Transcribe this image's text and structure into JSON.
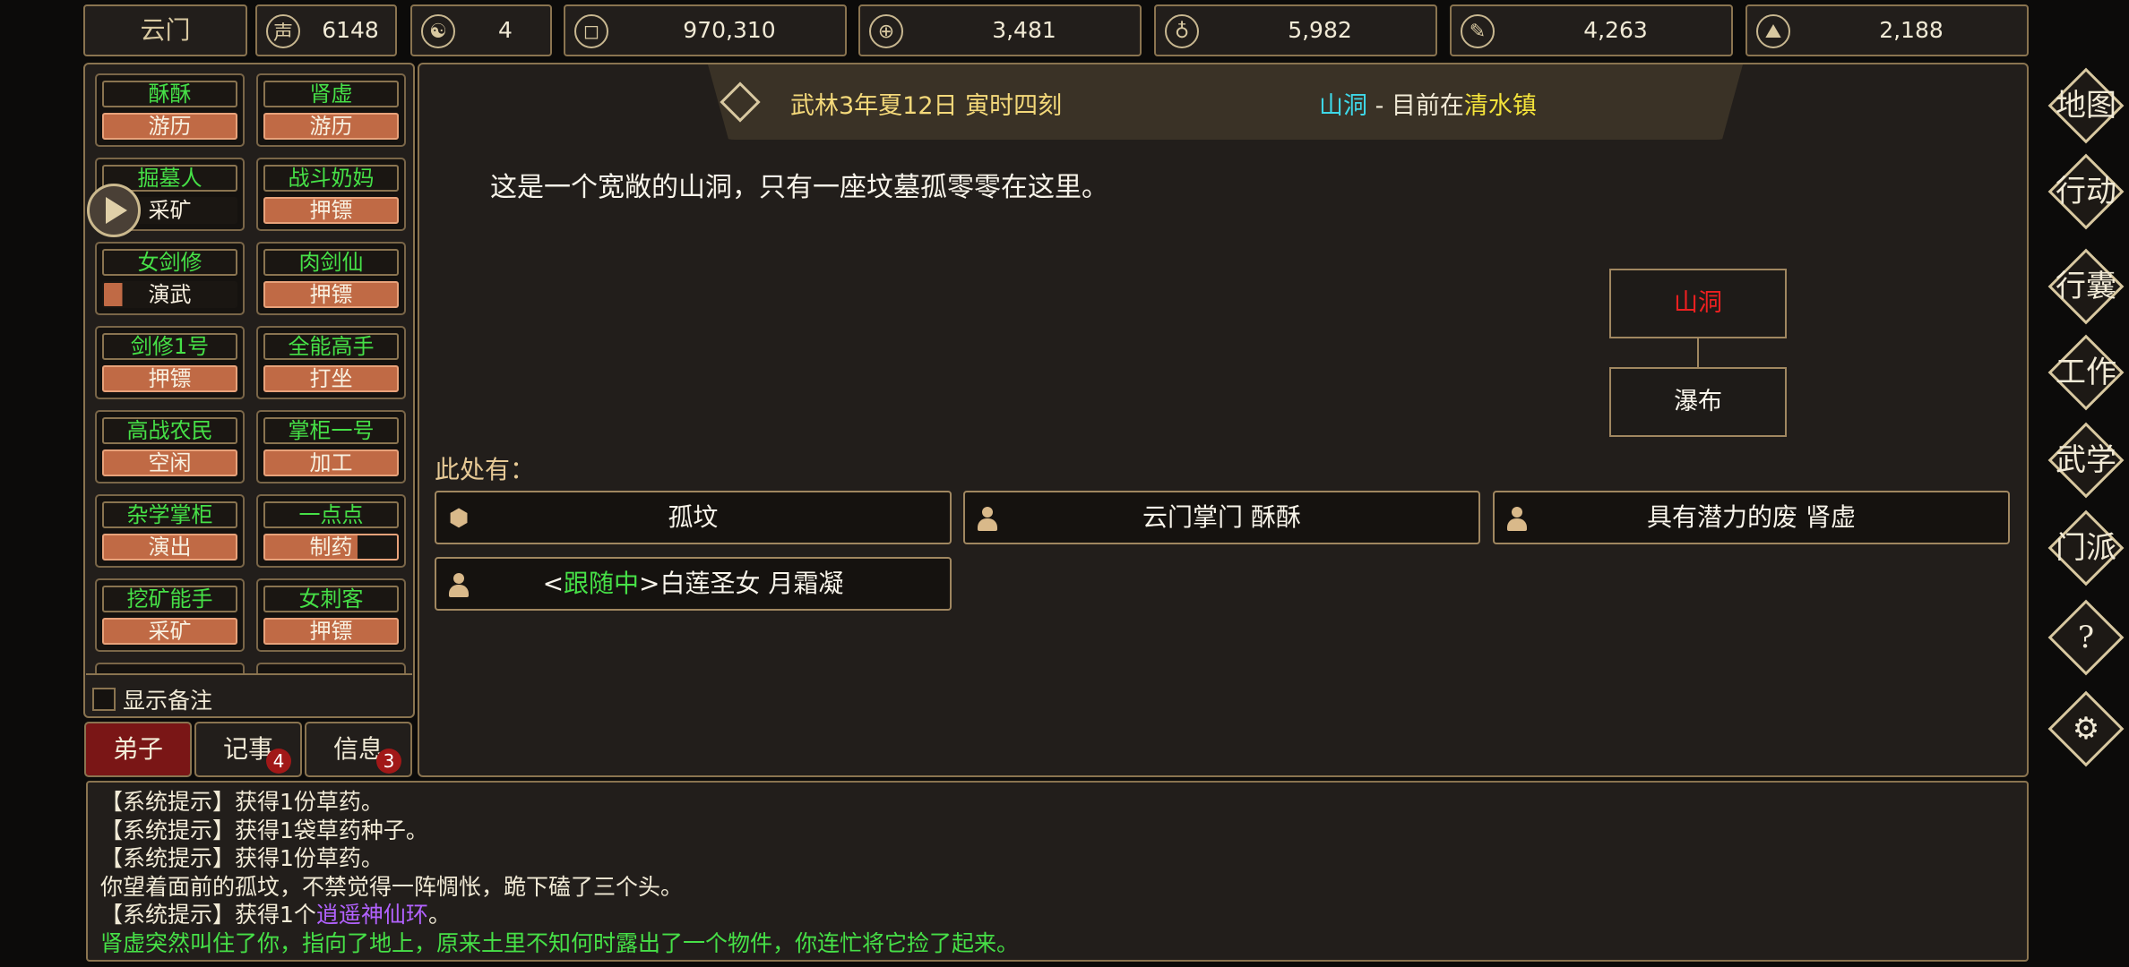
{
  "sect": {
    "name": "云门"
  },
  "resources": [
    {
      "icon": "reputation-icon",
      "glyph": "声",
      "value": "6148"
    },
    {
      "icon": "yin-yang-icon",
      "glyph": "☯",
      "value": "4"
    },
    {
      "icon": "coin-icon",
      "glyph": "◻",
      "value": "970,310"
    },
    {
      "icon": "rice-bowl-icon",
      "glyph": "⊕",
      "value": "3,481"
    },
    {
      "icon": "gourd-icon",
      "glyph": "♁",
      "value": "5,982"
    },
    {
      "icon": "scroll-icon",
      "glyph": "✎",
      "value": "4,263"
    },
    {
      "icon": "ore-icon",
      "glyph": "⛰",
      "value": "2,188"
    }
  ],
  "disciples": [
    {
      "name": "酥酥",
      "activity": "游历"
    },
    {
      "name": "肾虚",
      "activity": "游历"
    },
    {
      "name": "掘墓人",
      "activity": "采矿"
    },
    {
      "name": "战斗奶妈",
      "activity": "押镖"
    },
    {
      "name": "女剑修",
      "activity": "演武"
    },
    {
      "name": "肉剑仙",
      "activity": "押镖"
    },
    {
      "name": "剑修1号",
      "activity": "押镖"
    },
    {
      "name": "全能高手",
      "activity": "打坐"
    },
    {
      "name": "高战农民",
      "activity": "空闲"
    },
    {
      "name": "掌柜一号",
      "activity": "加工"
    },
    {
      "name": "杂学掌柜",
      "activity": "演出"
    },
    {
      "name": "一点点",
      "activity": "制药"
    },
    {
      "name": "挖矿能手",
      "activity": "采矿"
    },
    {
      "name": "女刺客",
      "activity": "押镖"
    }
  ],
  "show_notes_label": "显示备注",
  "tabs": {
    "disciples": "弟子",
    "journal": "记事",
    "journal_badge": "4",
    "messages": "信息",
    "messages_badge": "3"
  },
  "header": {
    "date": "武林3年夏12日 寅时四刻",
    "location": "山洞",
    "separator": " - 目前在",
    "town": "清水镇"
  },
  "description": "这是一个宽敞的山洞，只有一座坟墓孤零零在这里。",
  "map": {
    "current": "山洞",
    "exit": "瀑布"
  },
  "here_label": "此处有：",
  "objects": [
    {
      "label": "孤坟",
      "icon": "box-icon"
    },
    {
      "label": "云门掌门 酥酥",
      "icon": "person-icon"
    },
    {
      "label": "具有潜力的废 肾虚",
      "icon": "person-icon"
    }
  ],
  "follower": {
    "open": "<",
    "status": "跟随中",
    "close": ">",
    "name": "白莲圣女 月霜凝"
  },
  "right_menu": [
    {
      "label": "地图",
      "icon": "map-icon"
    },
    {
      "label": "行动",
      "icon": "action-icon"
    },
    {
      "label": "行囊",
      "icon": "bag-icon"
    },
    {
      "label": "工作",
      "icon": "work-icon"
    },
    {
      "label": "武学",
      "icon": "martial-icon"
    },
    {
      "label": "门派",
      "icon": "sect-icon"
    },
    {
      "label": "?",
      "icon": "help-icon"
    },
    {
      "label": "⚙",
      "icon": "settings-icon"
    }
  ],
  "log": {
    "line1": "【系统提示】获得1份草药。",
    "line2": "【系统提示】获得1袋草药种子。",
    "line3": "【系统提示】获得1份草药。",
    "line4": "你望着面前的孤坟，不禁觉得一阵惆怅，跪下磕了三个头。",
    "line5_prefix": "【系统提示】获得1个",
    "line5_item": "逍遥神仙环",
    "line5_suffix": "。",
    "line6": "肾虚突然叫住了你，指向了地上，原来土里不知何时露出了一个物件，你连忙将它捡了起来。"
  }
}
